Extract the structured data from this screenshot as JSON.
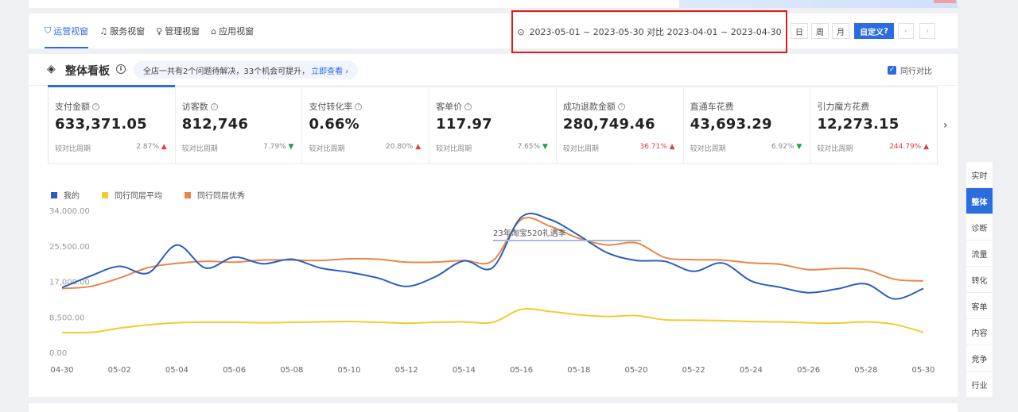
{
  "views": [
    {
      "label": "运营视窗",
      "icon": "shield-icon",
      "active": true
    },
    {
      "label": "服务视窗",
      "icon": "headset-icon",
      "active": false
    },
    {
      "label": "管理视窗",
      "icon": "bulb-icon",
      "active": false
    },
    {
      "label": "应用视窗",
      "icon": "store-icon",
      "active": false
    }
  ],
  "date_range": "2023-05-01 ~ 2023-05-30 对比 2023-04-01 ~ 2023-04-30",
  "periods": {
    "day": "日",
    "week": "周",
    "month": "月",
    "custom": "自定义"
  },
  "panel": {
    "title": "整体看板",
    "notice": "全店一共有2个问题待解决，33个机会可提升，",
    "notice_link": "立即查看",
    "compare_label": "同行对比"
  },
  "metrics": [
    {
      "label": "支付金额",
      "value": "633,371.05",
      "compare": "较对比周期",
      "pct": "2.87%",
      "trend": "up",
      "highlight": false
    },
    {
      "label": "访客数",
      "value": "812,746",
      "compare": "较对比周期",
      "pct": "7.79%",
      "trend": "down",
      "highlight": false
    },
    {
      "label": "支付转化率",
      "value": "0.66%",
      "compare": "较对比周期",
      "pct": "20.80%",
      "trend": "up",
      "highlight": false
    },
    {
      "label": "客单价",
      "value": "117.97",
      "compare": "较对比周期",
      "pct": "7.65%",
      "trend": "down",
      "highlight": false
    },
    {
      "label": "成功退款金额",
      "value": "280,749.46",
      "compare": "较对比周期",
      "pct": "36.71%",
      "trend": "up",
      "highlight": true
    },
    {
      "label": "直通车花费",
      "value": "43,693.29",
      "compare": "较对比周期",
      "pct": "6.92%",
      "trend": "down",
      "highlight": false
    },
    {
      "label": "引力魔方花费",
      "value": "12,273.15",
      "compare": "较对比周期",
      "pct": "244.79%",
      "trend": "up",
      "highlight": true
    }
  ],
  "side_nav": [
    "实时",
    "整体",
    "诊断",
    "流量",
    "转化",
    "客单",
    "内容",
    "竞争",
    "行业"
  ],
  "side_nav_active": 1,
  "chart_data": {
    "type": "line",
    "x": [
      "04-30",
      "05-01",
      "05-02",
      "05-03",
      "05-04",
      "05-05",
      "05-06",
      "05-07",
      "05-08",
      "05-09",
      "05-10",
      "05-11",
      "05-12",
      "05-13",
      "05-14",
      "05-15",
      "05-16",
      "05-17",
      "05-18",
      "05-19",
      "05-20",
      "05-21",
      "05-22",
      "05-23",
      "05-24",
      "05-25",
      "05-26",
      "05-27",
      "05-28",
      "05-29",
      "05-30"
    ],
    "x_tick_labels": [
      "04-30",
      "05-02",
      "05-04",
      "05-06",
      "05-08",
      "05-10",
      "05-12",
      "05-14",
      "05-16",
      "05-18",
      "05-20",
      "05-22",
      "05-24",
      "05-26",
      "05-28",
      "05-30"
    ],
    "y_ticks": [
      "34,000.00",
      "25,500.00",
      "17,000.00",
      "8,500.00",
      "0.00"
    ],
    "ylim": [
      0,
      34000
    ],
    "series": [
      {
        "name": "我的",
        "color": "#2a5fbd",
        "values": [
          15700,
          18500,
          20800,
          19200,
          25900,
          20400,
          23000,
          21400,
          22500,
          20400,
          19400,
          18000,
          16000,
          18300,
          22100,
          20500,
          32600,
          32000,
          28200,
          24000,
          22200,
          22000,
          19600,
          21600,
          17300,
          15800,
          14500,
          15400,
          16600,
          13000,
          15500
        ]
      },
      {
        "name": "同行同层平均",
        "color": "#f2cc2e",
        "values": [
          5000,
          5000,
          6000,
          6800,
          7300,
          7400,
          7400,
          7300,
          7400,
          7500,
          7600,
          7400,
          7200,
          7400,
          7500,
          7400,
          10500,
          10000,
          9200,
          8800,
          9000,
          8000,
          7900,
          7800,
          7600,
          7500,
          7300,
          7200,
          7500,
          6900,
          5000
        ]
      },
      {
        "name": "同行同层优秀",
        "color": "#e8874a",
        "values": [
          15500,
          16000,
          18000,
          20500,
          21500,
          22000,
          21800,
          22300,
          22300,
          22200,
          22600,
          22500,
          21800,
          21800,
          22200,
          22100,
          32000,
          30400,
          27500,
          25900,
          26400,
          22900,
          22400,
          22300,
          21600,
          21300,
          20000,
          20300,
          20000,
          17700,
          17300
        ]
      }
    ],
    "annotation": "23年淘宝520礼遇季",
    "legend_position": "top-left",
    "grid": false
  }
}
